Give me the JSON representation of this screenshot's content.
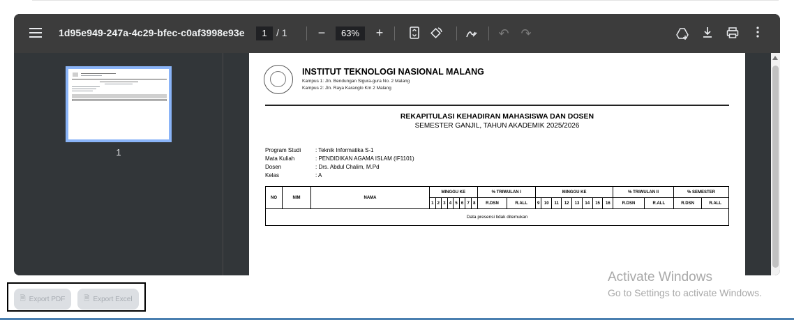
{
  "viewer": {
    "document_title": "1d95e949-247a-4c29-bfec-c0af3998e93e",
    "current_page": "1",
    "page_separator": "/",
    "total_pages": "1",
    "zoom": "63%",
    "icons": {
      "menu": "menu-icon",
      "zoom_out": "minus-icon",
      "zoom_in": "plus-icon",
      "fit_page": "fit-page-icon",
      "rotate": "rotate-icon",
      "annotate": "annotate-icon",
      "undo": "undo-icon",
      "redo": "redo-icon",
      "add_drive": "add-to-drive-icon",
      "download": "download-icon",
      "print": "print-icon",
      "more": "more-vert-icon"
    }
  },
  "sidebar": {
    "thumbnail_label": "1"
  },
  "document": {
    "institution": "INSTITUT TEKNOLOGI NASIONAL MALANG",
    "campus1": "Kampus 1: Jln. Bendungan Sigura-gura No. 2 Malang",
    "campus2": "Kampus 2: Jln. Raya Karanglo Km 2 Malang",
    "report_title": "REKAPITULASI KEHADIRAN MAHASISWA DAN DOSEN",
    "semester": "SEMESTER GANJIL, TAHUN AKADEMIK 2025/2026",
    "info": [
      {
        "label": "Program Studi",
        "value": ": Teknik Informatika S-1"
      },
      {
        "label": "Mata Kuliah",
        "value": ": PENDIDIKAN AGAMA ISLAM  (IF1101)"
      },
      {
        "label": "Dosen",
        "value": ": Drs. Abdul Chalim, M.Pd"
      },
      {
        "label": "Kelas",
        "value": ": A"
      }
    ],
    "table": {
      "no": "NO",
      "nim": "NIM",
      "nama": "NAMA",
      "minggu_ke": "MINGGU KE",
      "triwulan1": "% TRIWULAN I",
      "triwulan2": "% TRIWULAN II",
      "semester": "% SEMESTER",
      "weeks_a": [
        "1",
        "2",
        "3",
        "4",
        "5",
        "6",
        "7",
        "8"
      ],
      "weeks_b": [
        "9",
        "10",
        "11",
        "12",
        "13",
        "14",
        "15",
        "16"
      ],
      "r_dsn": "R.DSN",
      "r_all": "R.ALL",
      "empty_message": "Data presensi tidak ditemukan"
    }
  },
  "actions": {
    "export_pdf": "Export PDF",
    "export_excel": "Export Excel"
  },
  "watermark": {
    "title": "Activate Windows",
    "subtitle": "Go to Settings to activate Windows."
  }
}
